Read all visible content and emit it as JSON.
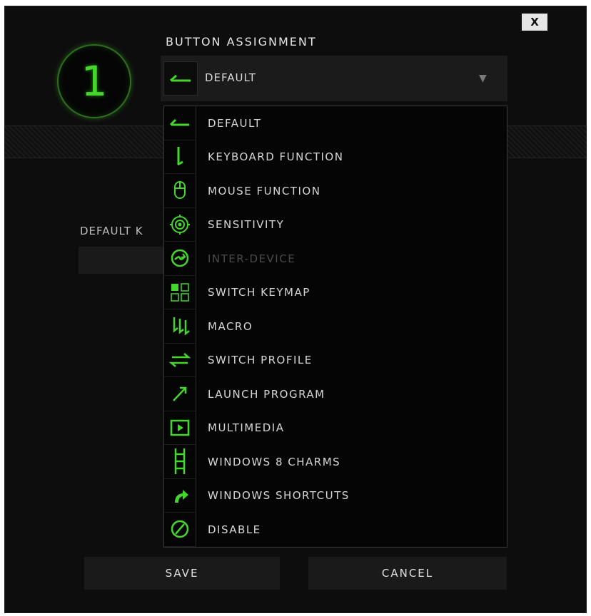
{
  "dialog": {
    "close_label": "X",
    "badge_number": "1",
    "section_title": "BUTTON ASSIGNMENT",
    "default_key_label": "DEFAULT K"
  },
  "dropdown": {
    "selected_value": "DEFAULT",
    "selected_icon": "arrow-left-icon",
    "arrow": "▼"
  },
  "menu": {
    "items": [
      {
        "label": "DEFAULT",
        "icon": "arrow-left-icon",
        "enabled": true
      },
      {
        "label": "KEYBOARD FUNCTION",
        "icon": "keyboard-key-icon",
        "enabled": true
      },
      {
        "label": "MOUSE FUNCTION",
        "icon": "mouse-icon",
        "enabled": true
      },
      {
        "label": "SENSITIVITY",
        "icon": "target-icon",
        "enabled": true
      },
      {
        "label": "INTER-DEVICE",
        "icon": "inter-device-icon",
        "enabled": false
      },
      {
        "label": "SWITCH KEYMAP",
        "icon": "grid-icon",
        "enabled": true
      },
      {
        "label": "MACRO",
        "icon": "macro-icon",
        "enabled": true
      },
      {
        "label": "SWITCH PROFILE",
        "icon": "switch-arrows-icon",
        "enabled": true
      },
      {
        "label": "LAUNCH PROGRAM",
        "icon": "launch-arrow-icon",
        "enabled": true
      },
      {
        "label": "MULTIMEDIA",
        "icon": "play-icon",
        "enabled": true
      },
      {
        "label": "WINDOWS 8 CHARMS",
        "icon": "charms-icon",
        "enabled": true
      },
      {
        "label": "WINDOWS SHORTCUTS",
        "icon": "shortcut-arrow-icon",
        "enabled": true
      },
      {
        "label": "DISABLE",
        "icon": "disable-icon",
        "enabled": true
      }
    ]
  },
  "buttons": {
    "save_label": "SAVE",
    "cancel_label": "CANCEL"
  },
  "colors": {
    "accent": "#44d62c",
    "background": "#0d0d0d",
    "disabled_text": "#4a4a4a"
  }
}
